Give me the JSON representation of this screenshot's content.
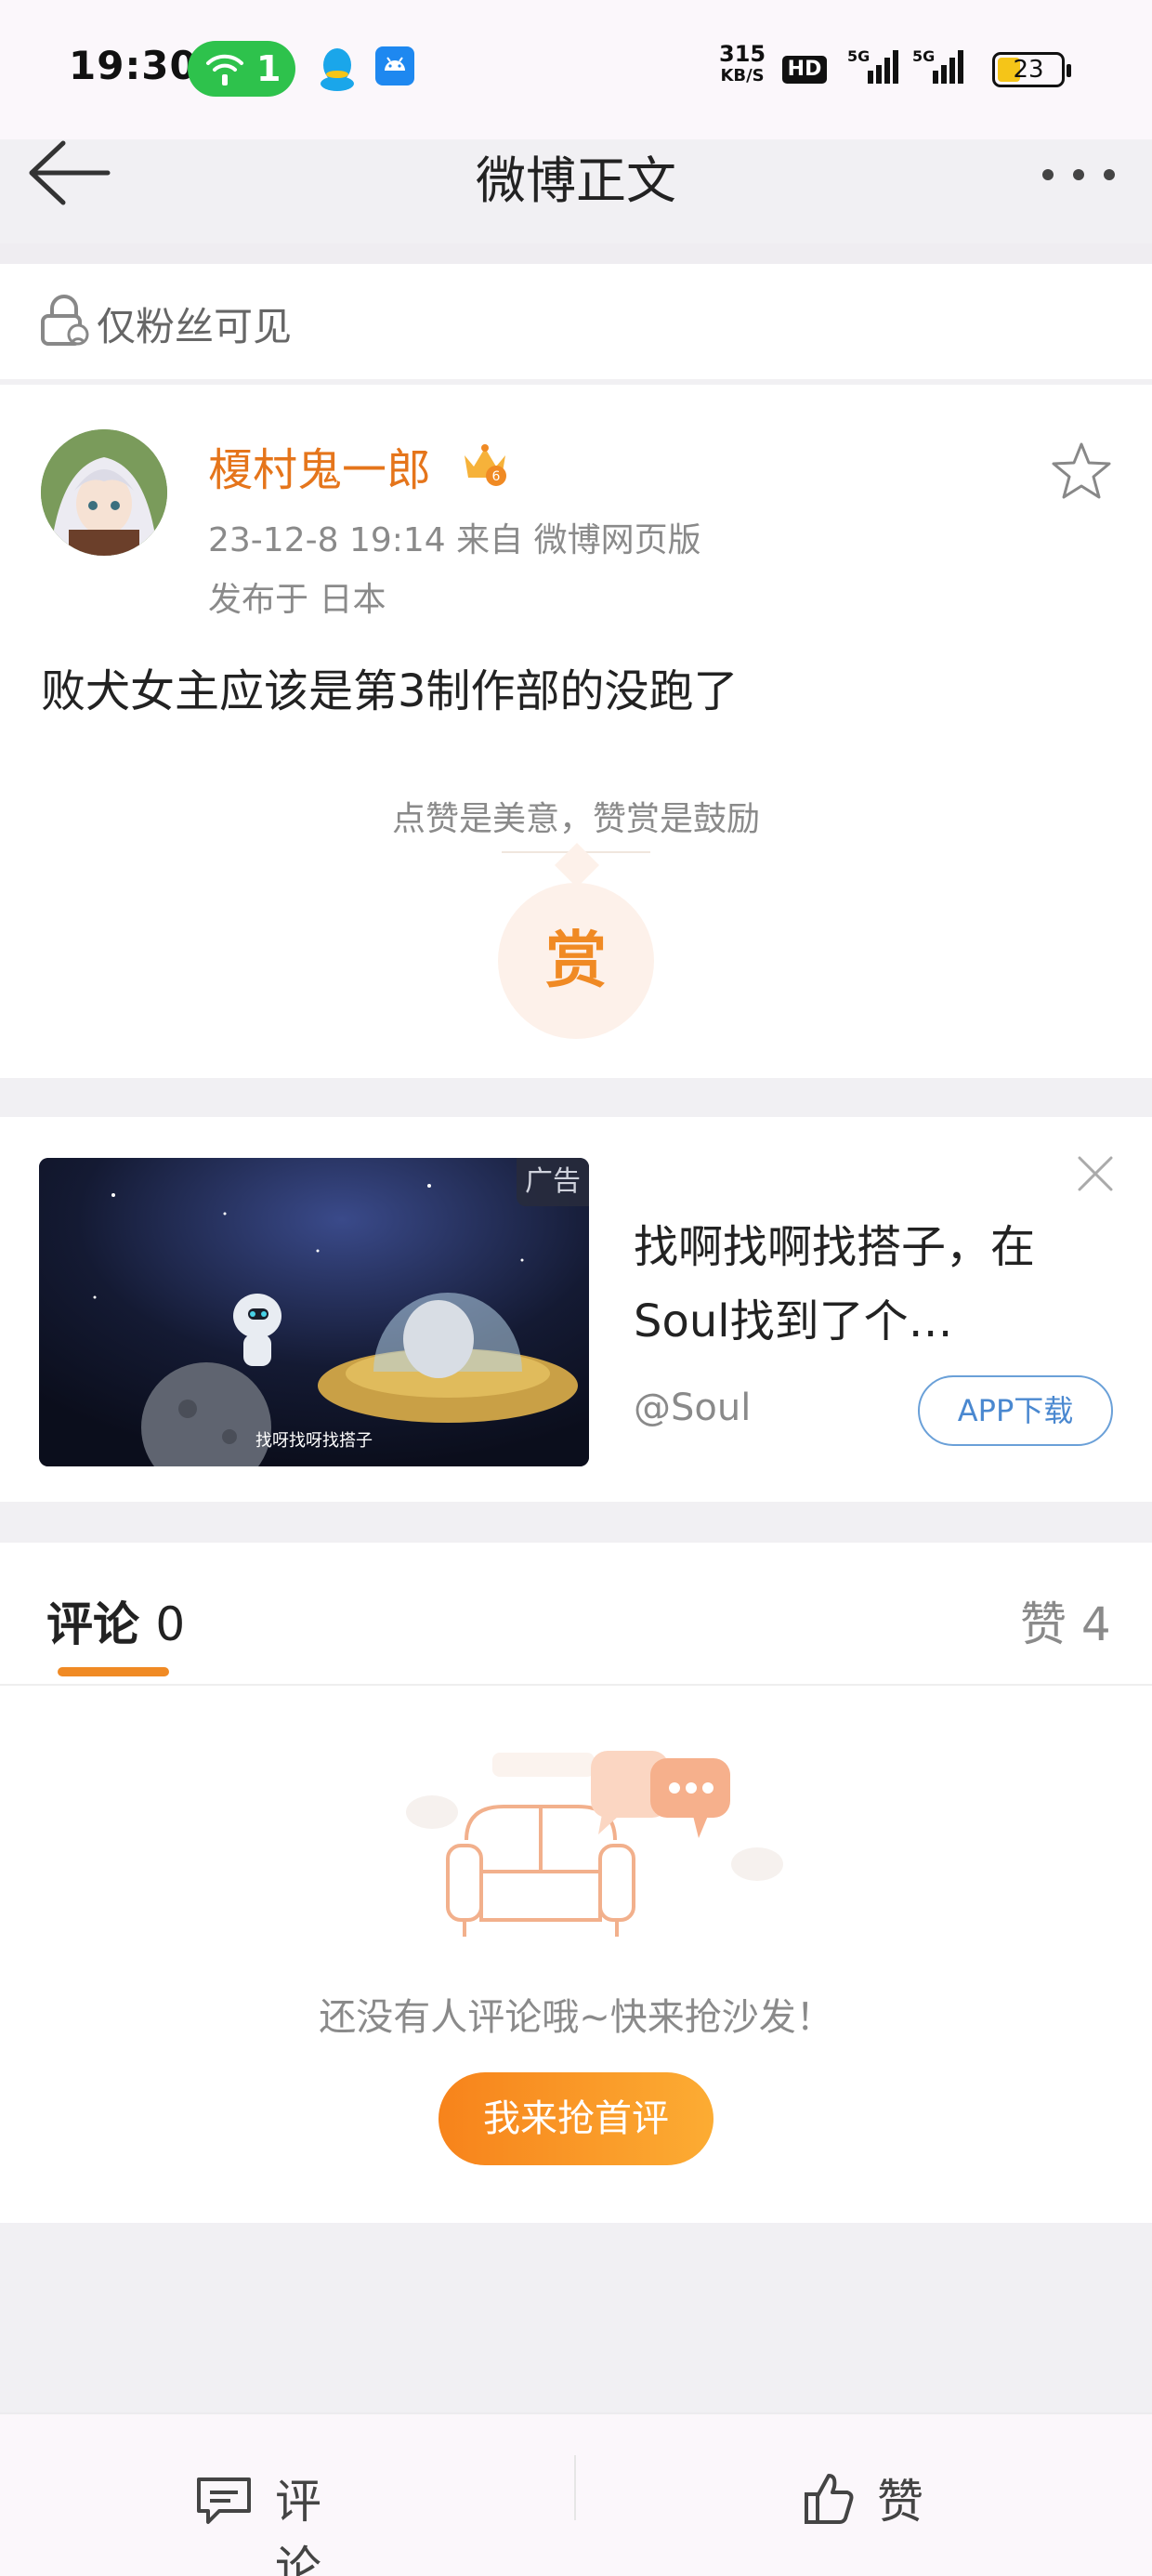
{
  "status_bar": {
    "time": "19:30",
    "wifi_count": "1",
    "speed_value": "315",
    "speed_unit": "KB/S",
    "hd_label": "HD",
    "signal1_label": "5G",
    "signal2_label": "5G",
    "battery_level": "23"
  },
  "nav": {
    "title": "微博正文"
  },
  "visibility": {
    "label": "仅粉丝可见"
  },
  "post": {
    "username": "榎村鬼一郎",
    "time_source": "23-12-8 19:14   来自 微博网页版",
    "location": "发布于 日本",
    "text": "败犬女主应该是第3制作部的没跑了",
    "reward_hint": "点赞是美意，赞赏是鼓励",
    "reward_button": "赏"
  },
  "ad": {
    "badge": "广告",
    "image_caption": "找呀找呀找搭子",
    "title": "找啊找啊找搭子，在Soul找到了个…",
    "account": "@Soul",
    "button": "APP下载"
  },
  "comments": {
    "tab_comments": "评论",
    "comment_count": "0",
    "tab_likes": "赞 4",
    "empty_text": "还没有人评论哦~快来抢沙发！",
    "first_comment_button": "我来抢首评"
  },
  "bottom_bar": {
    "comment_label": "评论",
    "like_label": "赞"
  },
  "colors": {
    "accent": "#f08a24",
    "username": "#e5751b",
    "link": "#4a88d0"
  }
}
